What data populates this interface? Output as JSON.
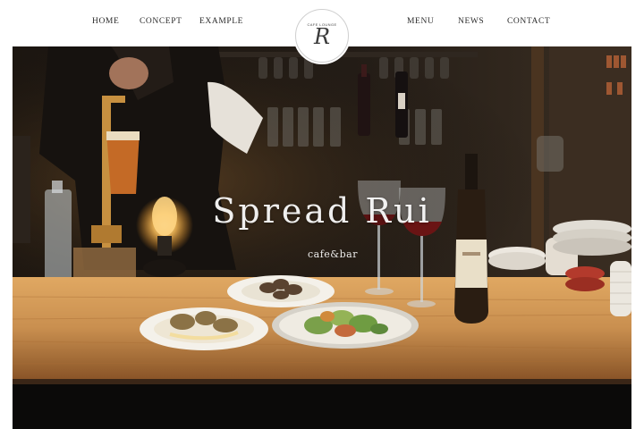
{
  "nav": {
    "home": "HOME",
    "concept": "CONCEPT",
    "example": "EXAMPLE",
    "menu": "MENU",
    "news": "NEWS",
    "contact": "CONTACT"
  },
  "logo": {
    "top_text": "CAFE LOUNGE",
    "mark": "R"
  },
  "hero": {
    "title": "Spread Rui",
    "subtitle": "cafe&bar"
  },
  "colors": {
    "nav_text": "#2b2b2b",
    "hero_bg": "#0d0b09",
    "counter_wood": "#c98f4f"
  }
}
